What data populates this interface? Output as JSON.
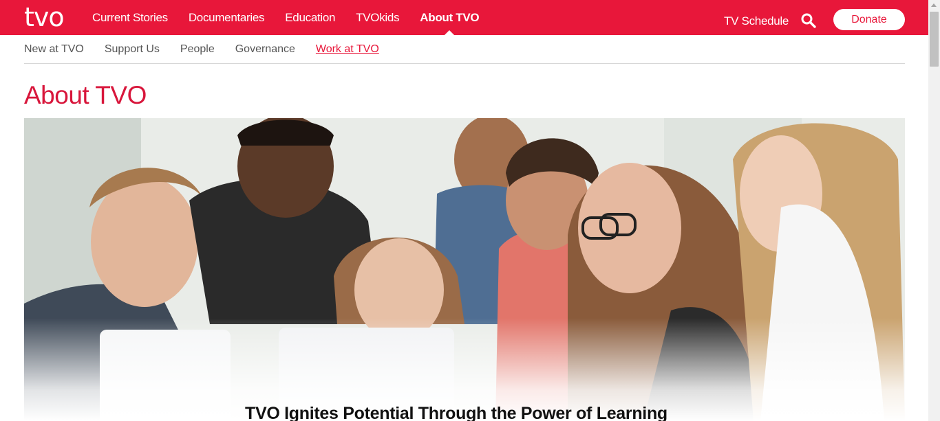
{
  "header": {
    "logo": "tvo",
    "nav": [
      {
        "label": "Current Stories"
      },
      {
        "label": "Documentaries"
      },
      {
        "label": "Education"
      },
      {
        "label": "TVOkids"
      },
      {
        "label": "About TVO",
        "active": true
      }
    ],
    "tv_schedule": "TV Schedule",
    "search_icon": "search-icon",
    "donate": "Donate",
    "brand_color": "#e8173a"
  },
  "subnav": {
    "items": [
      {
        "label": "New at TVO"
      },
      {
        "label": "Support Us"
      },
      {
        "label": "People"
      },
      {
        "label": "Governance"
      },
      {
        "label": "Work at TVO",
        "current": true
      }
    ]
  },
  "page": {
    "title": "About TVO"
  },
  "hero": {
    "image": "photo-of-children-looking-at-laptops",
    "heading": "TVO Ignites Potential Through the Power of Learning"
  }
}
